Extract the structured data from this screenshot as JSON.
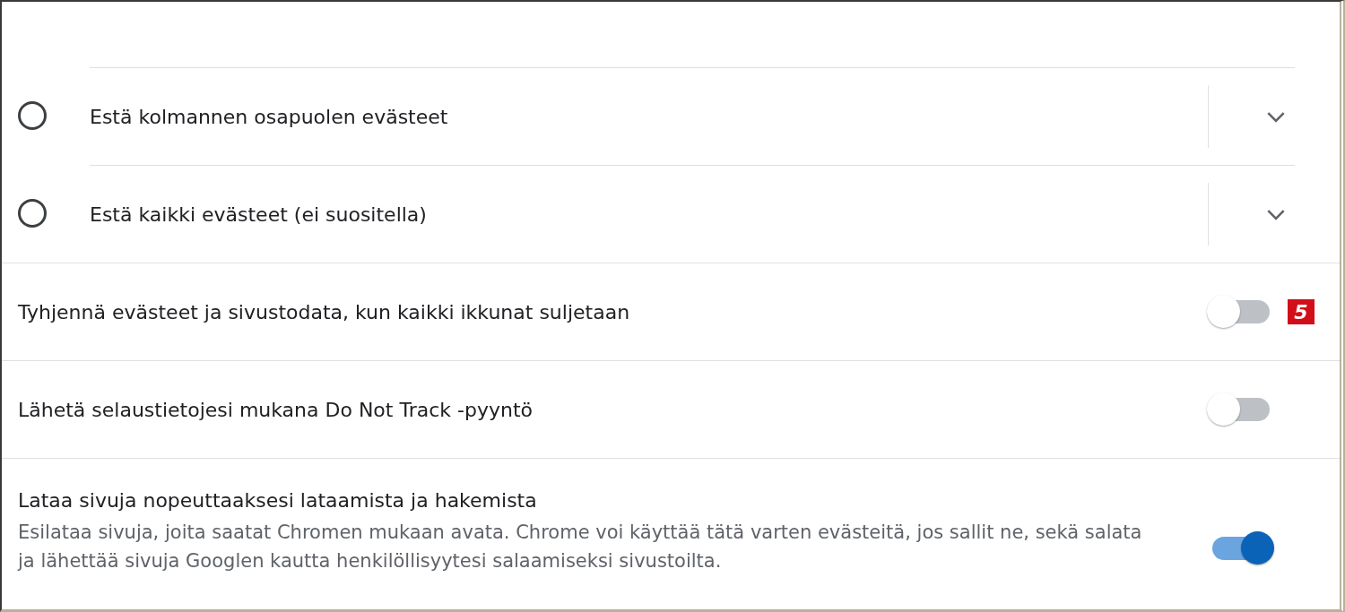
{
  "radio_options": [
    {
      "label": "Estä kolmannen osapuolen evästeet",
      "selected": false
    },
    {
      "label": "Estä kaikki evästeet (ei suositella)",
      "selected": false
    }
  ],
  "toggles": [
    {
      "label": "Tyhjennä evästeet ja sivustodata, kun kaikki ikkunat suljetaan",
      "on": false,
      "badge": "5"
    },
    {
      "label": "Lähetä selaustietojesi mukana Do Not Track -pyyntö",
      "on": false
    },
    {
      "label": "Lataa sivuja nopeuttaaksesi lataamista ja hakemista",
      "description": "Esilataa sivuja, joita saatat Chromen mukaan avata. Chrome voi käyttää tätä varten evästeitä, jos sallit ne, sekä salata ja lähettää sivuja Googlen kautta henkilöllisyytesi salaamiseksi sivustoilta.",
      "on": true
    }
  ]
}
